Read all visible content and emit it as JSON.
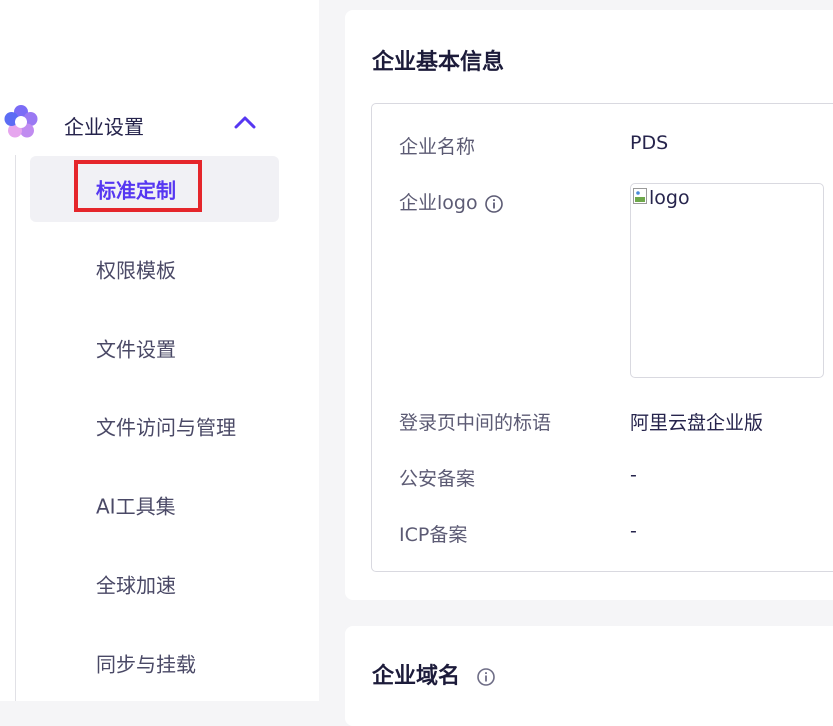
{
  "sidebar": {
    "group": {
      "label": "企业设置",
      "icon": "flower-logo-icon",
      "chevron": "chevron-up-icon"
    },
    "items": [
      {
        "label": "标准定制",
        "active": true
      },
      {
        "label": "权限模板"
      },
      {
        "label": "文件设置"
      },
      {
        "label": "文件访问与管理"
      },
      {
        "label": "AI工具集"
      },
      {
        "label": "全球加速"
      },
      {
        "label": "同步与挂载"
      }
    ]
  },
  "basic_info": {
    "title": "企业基本信息",
    "rows": {
      "name": {
        "label": "企业名称",
        "value": "PDS"
      },
      "logo": {
        "label": "企业logo",
        "alt": "logo",
        "icon": "info-icon"
      },
      "slogan": {
        "label": "登录页中间的标语",
        "value": "阿里云盘企业版"
      },
      "police": {
        "label": "公安备案",
        "value": "-"
      },
      "icp": {
        "label": "ICP备案",
        "value": "-"
      }
    }
  },
  "domain_card": {
    "title": "企业域名",
    "icon": "info-icon"
  },
  "colors": {
    "accent": "#5637f2",
    "highlight": "#e5262b",
    "page_bg": "#f5f5f7"
  }
}
